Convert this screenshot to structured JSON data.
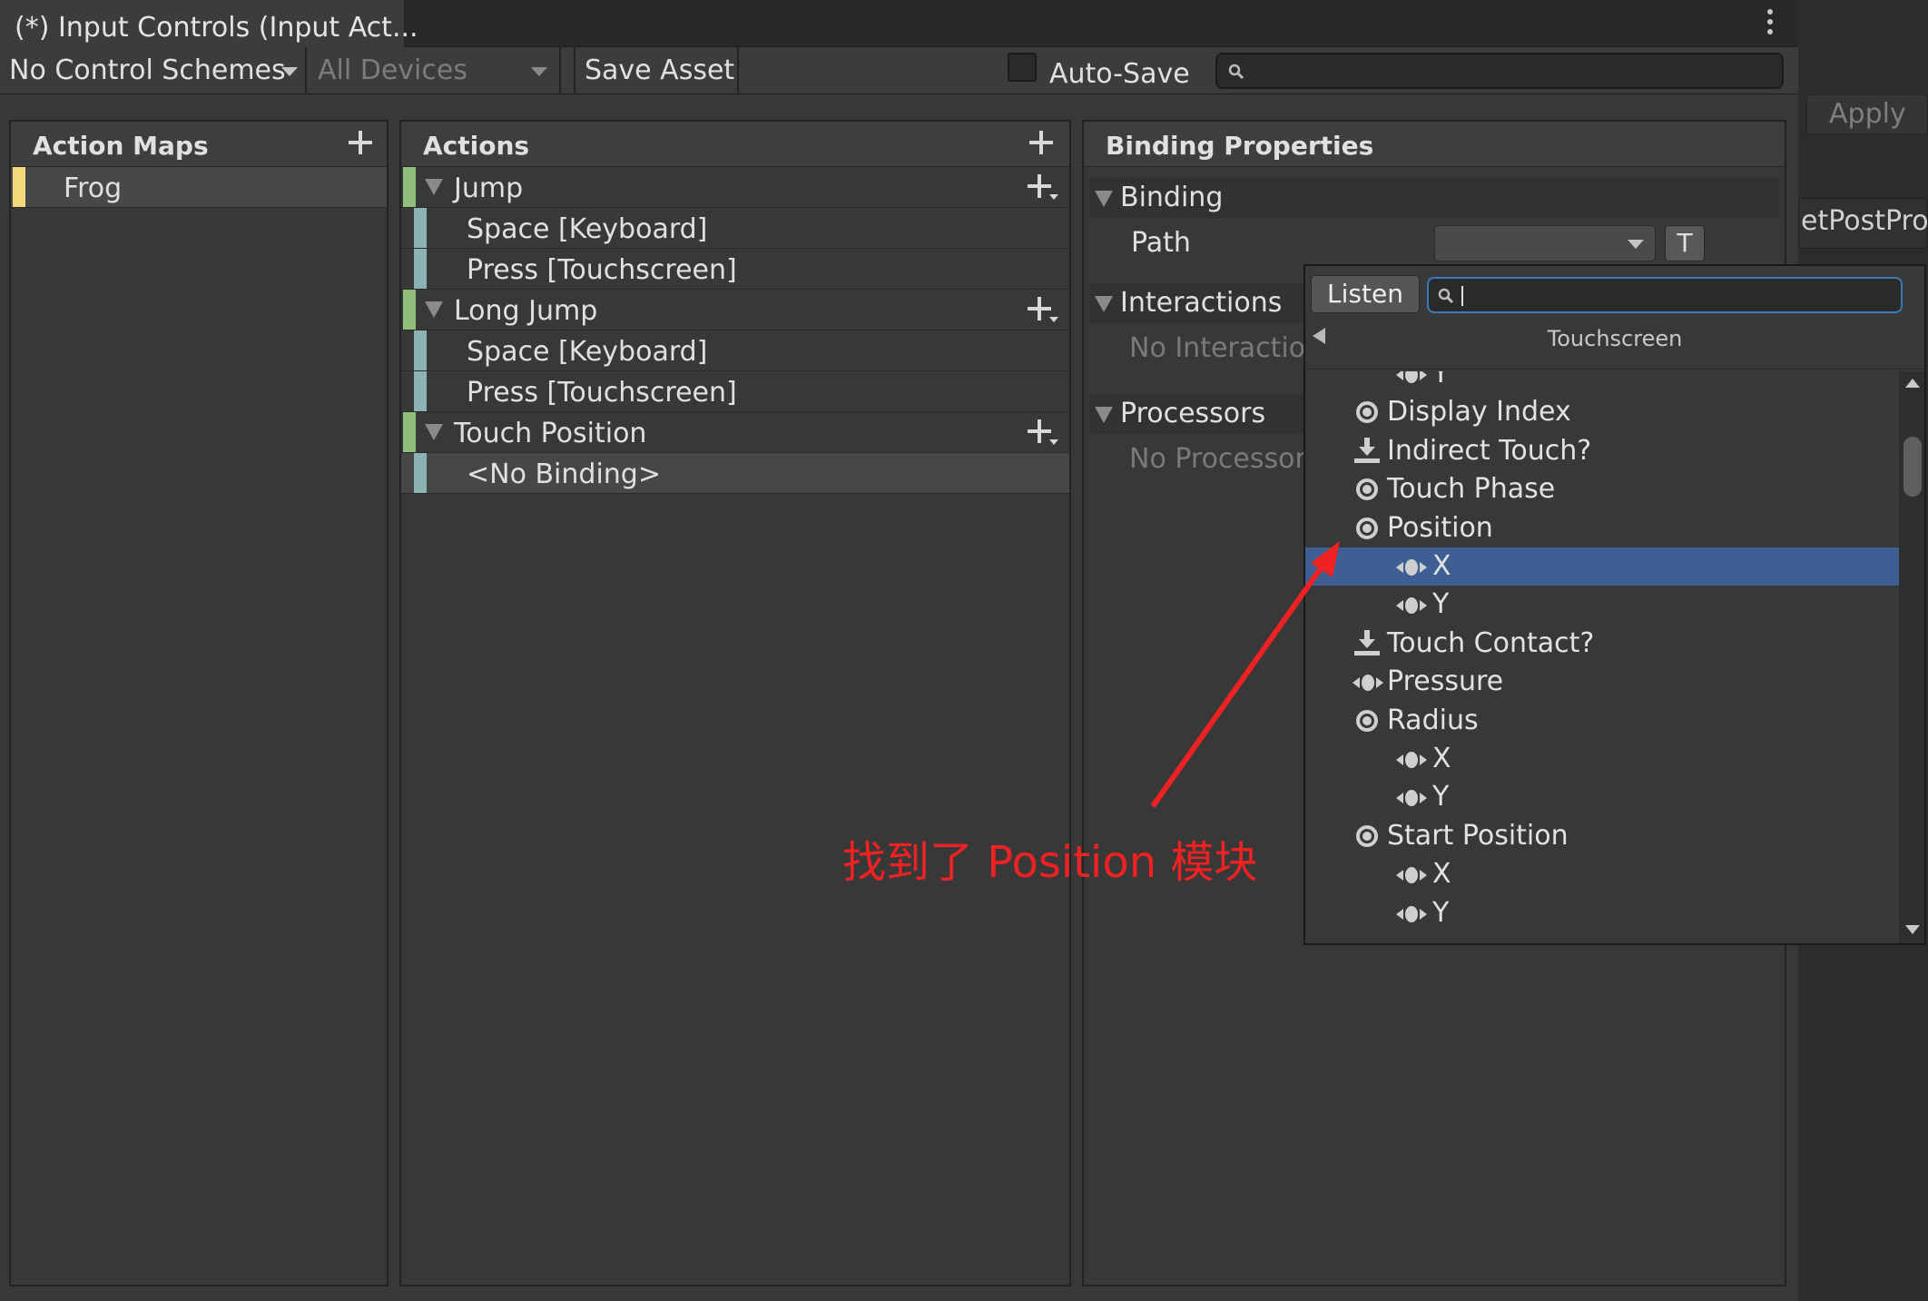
{
  "window": {
    "tab_title": "(*) Input Controls (Input Act...",
    "right_apply": "Apply",
    "right_postproc": "etPostProc"
  },
  "toolbar": {
    "control_schemes": "No Control Schemes",
    "devices": "All Devices",
    "save_asset": "Save Asset",
    "auto_save": "Auto-Save",
    "search_value": ""
  },
  "action_maps": {
    "title": "Action Maps",
    "items": [
      {
        "label": "Frog",
        "color": "#f4d97a"
      }
    ]
  },
  "actions": {
    "title": "Actions",
    "rows": [
      {
        "type": "action",
        "label": "Jump"
      },
      {
        "type": "binding",
        "label": "Space [Keyboard]"
      },
      {
        "type": "binding",
        "label": "Press [Touchscreen]"
      },
      {
        "type": "action",
        "label": "Long Jump"
      },
      {
        "type": "binding",
        "label": "Space [Keyboard]"
      },
      {
        "type": "binding",
        "label": "Press [Touchscreen]"
      },
      {
        "type": "action",
        "label": "Touch Position"
      },
      {
        "type": "binding",
        "label": "<No Binding>"
      }
    ],
    "action_color": "#8fbf7a",
    "binding_color": "#8db2b4"
  },
  "binding_properties": {
    "title": "Binding Properties",
    "binding_section": "Binding",
    "path_label": "Path",
    "path_value": "",
    "t_button": "T",
    "interactions_section": "Interactions",
    "no_interactions": "No Interaction",
    "processors_section": "Processors",
    "no_processors": "No Processors"
  },
  "popup": {
    "listen": "Listen",
    "search_value": "",
    "breadcrumb": "Touchscreen",
    "items": [
      {
        "icon": "axis-icon",
        "label": "Y",
        "indent": 1
      },
      {
        "icon": "stick-icon",
        "label": "Display Index",
        "indent": 0
      },
      {
        "icon": "button-icon",
        "label": "Indirect Touch?",
        "indent": 0
      },
      {
        "icon": "stick-icon",
        "label": "Touch Phase",
        "indent": 0
      },
      {
        "icon": "stick-icon",
        "label": "Position",
        "indent": 0
      },
      {
        "icon": "axis-icon",
        "label": "X",
        "indent": 1,
        "selected": true
      },
      {
        "icon": "axis-icon",
        "label": "Y",
        "indent": 1
      },
      {
        "icon": "button-icon",
        "label": "Touch Contact?",
        "indent": 0
      },
      {
        "icon": "axis-icon",
        "label": "Pressure",
        "indent": 0
      },
      {
        "icon": "stick-icon",
        "label": "Radius",
        "indent": 0
      },
      {
        "icon": "axis-icon",
        "label": "X",
        "indent": 1
      },
      {
        "icon": "axis-icon",
        "label": "Y",
        "indent": 1
      },
      {
        "icon": "stick-icon",
        "label": "Start Position",
        "indent": 0
      },
      {
        "icon": "axis-icon",
        "label": "X",
        "indent": 1
      },
      {
        "icon": "axis-icon",
        "label": "Y",
        "indent": 1
      }
    ],
    "selection_color": "#3d5f93"
  },
  "annotation": {
    "text": "找到了 Position 模块",
    "color": "#ee2222"
  }
}
